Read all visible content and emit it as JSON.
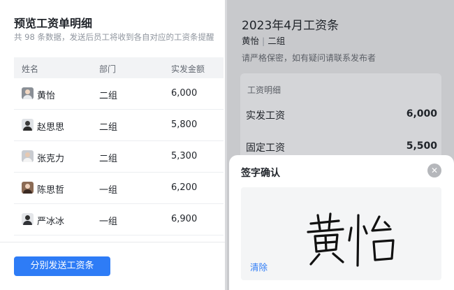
{
  "preview": {
    "title": "预览工资单明细",
    "subtitle": "共 98 条数据，发送后员工将收到各自对应的工资条提醒",
    "columns": [
      "姓名",
      "部门",
      "实发金额"
    ],
    "rows": [
      {
        "name": "黄怡",
        "dept": "二组",
        "amount": "6,000"
      },
      {
        "name": "赵思思",
        "dept": "二组",
        "amount": "5,800"
      },
      {
        "name": "张克力",
        "dept": "二组",
        "amount": "5,300"
      },
      {
        "name": "陈思哲",
        "dept": "一组",
        "amount": "6,200"
      },
      {
        "name": "严冰冰",
        "dept": "一组",
        "amount": "6,900"
      }
    ],
    "send_button": "分别发送工资条"
  },
  "payslip": {
    "title": "2023年4月工资条",
    "employee_name": "黄怡",
    "separator": "|",
    "employee_dept": "二组",
    "note": "请严格保密，如有疑问请联系发布者",
    "details_label": "工资明细",
    "items": [
      {
        "label": "实发工资",
        "value": "6,000"
      },
      {
        "label": "固定工资",
        "value": "5,500"
      }
    ]
  },
  "signature": {
    "title": "签字确认",
    "close_icon": "close-icon",
    "signature_text": "黄怡",
    "clear_label": "清除"
  },
  "colors": {
    "primary": "#2e7cf6",
    "overlay": "#c8c9cc"
  }
}
